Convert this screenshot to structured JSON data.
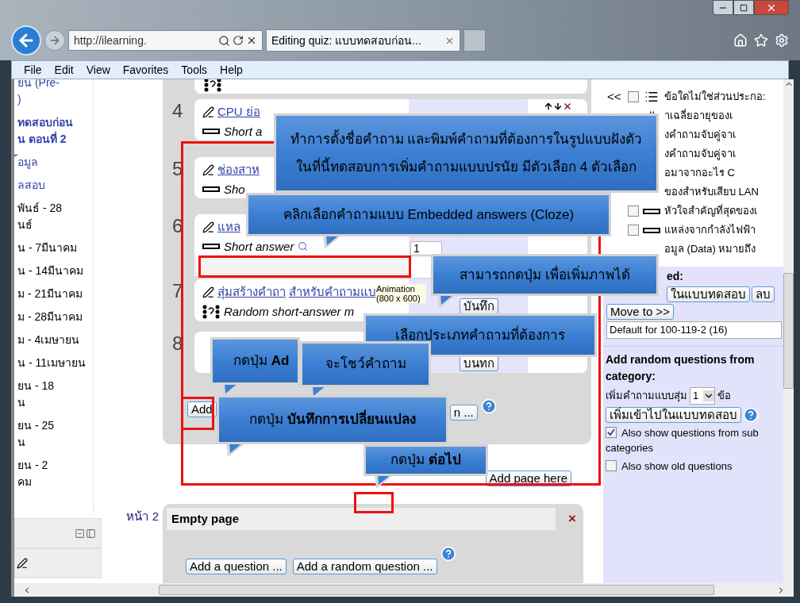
{
  "browser": {
    "address": "http://ilearning.",
    "tab_title": "Editing quiz: แบบทดสอบก่อน..."
  },
  "menu": [
    "File",
    "Edit",
    "View",
    "Favorites",
    "Tools",
    "Help"
  ],
  "sidebar": {
    "items": [
      {
        "kind": "link",
        "lines": [
          "ยน (Pre-",
          ")"
        ]
      },
      {
        "kind": "bold_link",
        "lines": [
          "ทดสอบก่อน",
          "น ตอนที่ 2"
        ]
      },
      {
        "kind": "link",
        "lines": [
          "้อมูล"
        ]
      },
      {
        "kind": "link",
        "lines": [
          "ลสอบ"
        ]
      },
      {
        "kind": "text",
        "lines": [
          "พันธ์ - 28",
          "นธ์"
        ]
      },
      {
        "kind": "text",
        "lines": [
          "น - 7มีนาคม"
        ]
      },
      {
        "kind": "text",
        "lines": [
          "น - 14มีนาคม"
        ]
      },
      {
        "kind": "text",
        "lines": [
          "ม - 21มีนาคม"
        ]
      },
      {
        "kind": "text",
        "lines": [
          "ม - 28มีนาคม"
        ]
      },
      {
        "kind": "text",
        "lines": [
          "ม - 4เมษายน"
        ]
      },
      {
        "kind": "text",
        "lines": [
          "น - 11เมษายน"
        ]
      },
      {
        "kind": "text",
        "lines": [
          "ยน - 18",
          "น"
        ]
      },
      {
        "kind": "text",
        "lines": [
          "ยน - 25",
          "น"
        ]
      },
      {
        "kind": "text",
        "lines": [
          "ยน - 2",
          "คม"
        ]
      }
    ]
  },
  "quiz": {
    "questions": [
      {
        "number": "4",
        "kind": "shortanswer",
        "titles": [
          "CPU ย่อ"
        ],
        "type": "Short a",
        "show_controls": true
      },
      {
        "number": "5",
        "kind": "shortanswer",
        "titles": [
          "ช่องสาห"
        ],
        "type": "Sho"
      },
      {
        "number": "6",
        "kind": "shortanswer",
        "titles": [
          "แหล"
        ],
        "type": "Short answer",
        "grade": "1"
      },
      {
        "number": "7",
        "kind": "random",
        "titles": [
          "สุ่มสร้างคำถา",
          "สำหรับคำถามแบ"
        ],
        "type": "Random short-answer m",
        "tooltip": "Animation (800 x 600)",
        "save_button": "บันทึก"
      },
      {
        "number": "8",
        "kind": "empty",
        "save_button": "บนทก"
      }
    ],
    "buttons": [
      "Add",
      "n ..."
    ],
    "add_page": "Add page here"
  },
  "page2": {
    "label": "หน้า 2",
    "title": "Empty page",
    "close": "×",
    "buttons": [
      "Add a question ...",
      "Add a random question ..."
    ]
  },
  "bank": {
    "items": [
      {
        "text": "ข้อใดไม่ใช่ส่วนประกอ:",
        "kind": "multichoice",
        "add": "<<",
        "checked": false
      },
      {
        "text": "าเฉลี่ยอายุของเ",
        "kind": "numerical"
      },
      {
        "text": "งคำถามจับคู่จาเ"
      },
      {
        "text": "งคำถามจับคู่จาเ"
      },
      {
        "text": "อมาจากอะไร C"
      },
      {
        "text": "ของสำหรับเสียบ LAN"
      },
      {
        "text": "หัวใจสำคัญที่สุดของเ",
        "kind": "shortanswer",
        "checked": false
      },
      {
        "text": "แหล่งจากกำลังไฟฟ้า",
        "kind": "shortanswer",
        "checked": false
      },
      {
        "text": "อมูล (Data) หมายถึง"
      }
    ],
    "selected": {
      "heading": "ed:",
      "add_button": "ในแบบทดสอบ",
      "delete_button": "ลบ",
      "move_button": "Move to >>",
      "category": "Default for 100-119-2 (16)"
    },
    "random": {
      "heading": "Add random questions from category:",
      "label": "เพิ่มคำถามแบบสุ่ม",
      "count": "1",
      "unit": "ข้อ",
      "button": "เพิ่มเข้าไปในแบบทดสอบ",
      "options": [
        {
          "lines": [
            "Also show questions from sub",
            "categories"
          ],
          "checked": true
        },
        {
          "lines": [
            "Also show old questions"
          ],
          "checked": false
        }
      ]
    }
  },
  "callouts": [
    {
      "lines": [
        "ทำการตั้งชื่อคำถาม  และพิมพ์คำถามที่ต้องการในรูปแบบฝังตัว",
        "ในที่นี้ทดสอบการเพิ่มคำถามแบบปรนัย มีตัวเลือก 4 ตัวเลือก"
      ]
    },
    {
      "lines": [
        "คลิกเลือกคำถามแบบ Embedded answers (Cloze)"
      ]
    },
    {
      "lines": [
        "สามารถกดปุ่ม เพื่อเพิ่มภาพได้"
      ]
    },
    {
      "lines": [
        "เลือกประเภทคำถามที่ต้องการ"
      ]
    },
    {
      "lines": [
        "กดปุ่ม **Ad**"
      ]
    },
    {
      "lines": [
        "จะโชว์คำถาม"
      ]
    },
    {
      "lines": [
        "กดปุ่ม **บันทึกการเปลี่ยนแปลง**"
      ]
    },
    {
      "lines": [
        "กดปุ่ม **ต่อไป**"
      ]
    }
  ]
}
